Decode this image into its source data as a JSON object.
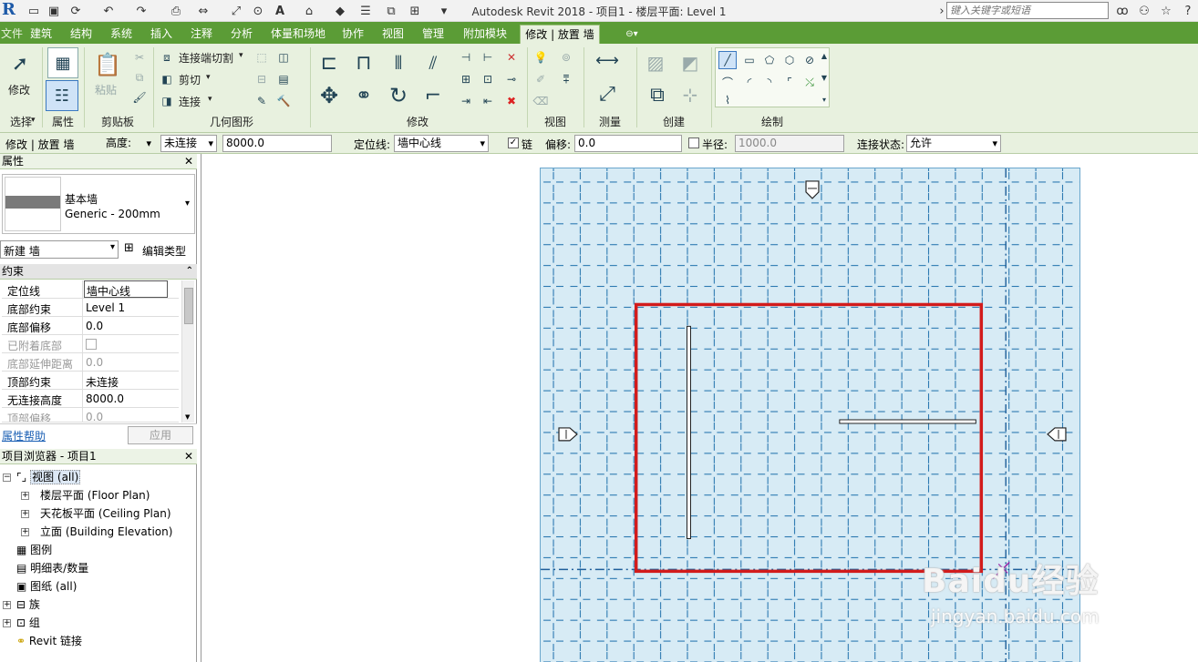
{
  "titlebar": {
    "app_logo": "R",
    "title": "Autodesk Revit 2018 -     项目1 - 楼层平面: Level 1",
    "search_placeholder": "键入关键字或短语",
    "icons": [
      "open-icon",
      "save-icon",
      "sync-icon",
      "undo-icon",
      "redo-icon",
      "print-icon",
      "measure-icon",
      "dimension-icon",
      "tag-icon",
      "text-icon",
      "3d-view-icon",
      "section-icon",
      "thin-lines-icon",
      "close-hidden-icon",
      "switch-windows-icon",
      "customize-icon",
      "binoculars-icon",
      "person-icon",
      "star-icon",
      "help-icon"
    ]
  },
  "tabs": [
    {
      "label": "文件"
    },
    {
      "label": "建筑"
    },
    {
      "label": "结构"
    },
    {
      "label": "系统"
    },
    {
      "label": "插入"
    },
    {
      "label": "注释"
    },
    {
      "label": "分析"
    },
    {
      "label": "体量和场地"
    },
    {
      "label": "协作"
    },
    {
      "label": "视图"
    },
    {
      "label": "管理"
    },
    {
      "label": "附加模块"
    },
    {
      "label": "修改 | 放置 墙",
      "active": true
    }
  ],
  "ribbon": {
    "modify_label": "修改",
    "paste_label": "粘贴",
    "join_cut_label": "连接端切割",
    "cut_label": "剪切",
    "join_label": "连接",
    "panels": {
      "select": "选择",
      "properties": "属性",
      "clipboard": "剪贴板",
      "geometry": "几何图形",
      "modify": "修改",
      "view": "视图",
      "measure": "测量",
      "create": "创建",
      "draw": "绘制"
    }
  },
  "optionsbar": {
    "context": "修改 | 放置 墙",
    "height_mode": "高度:",
    "top_constraint": "未连接",
    "height_value": "8000.0",
    "location_label": "定位线:",
    "location_value": "墙中心线",
    "chain_label": "链",
    "chain_checked": "✓",
    "offset_label": "偏移:",
    "offset_value": "0.0",
    "radius_label": "半径:",
    "radius_value": "1000.0",
    "join_status_label": "连接状态:",
    "join_status_value": "允许"
  },
  "properties": {
    "header": "属性",
    "type_family": "基本墙",
    "type_name": "Generic - 200mm",
    "instance_selector": "新建 墙",
    "edit_type": "编辑类型",
    "section": "约束",
    "rows": [
      {
        "key": "定位线",
        "value": "墙中心线",
        "dim": false
      },
      {
        "key": "底部约束",
        "value": "Level 1",
        "dim": false
      },
      {
        "key": "底部偏移",
        "value": "0.0",
        "dim": false
      },
      {
        "key": "已附着底部",
        "value": "",
        "dim": true
      },
      {
        "key": "底部延伸距离",
        "value": "0.0",
        "dim": true
      },
      {
        "key": "顶部约束",
        "value": "未连接",
        "dim": false
      },
      {
        "key": "无连接高度",
        "value": "8000.0",
        "dim": false
      },
      {
        "key": "顶部偏移",
        "value": "0.0",
        "dim": true
      }
    ],
    "help_link": "属性帮助",
    "apply": "应用"
  },
  "browser": {
    "header": "项目浏览器 - 项目1",
    "items": [
      {
        "label": "视图 (all)"
      },
      {
        "label": "楼层平面 (Floor Plan)"
      },
      {
        "label": "天花板平面 (Ceiling Plan)"
      },
      {
        "label": "立面 (Building Elevation)"
      },
      {
        "label": "图例"
      },
      {
        "label": "明细表/数量"
      },
      {
        "label": "图纸 (all)"
      },
      {
        "label": "族"
      },
      {
        "label": "组"
      },
      {
        "label": "Revit 链接"
      }
    ]
  },
  "watermark": {
    "brand": "Baidu经验",
    "url": "jingyan.baidu.com"
  },
  "colors": {
    "ribbon_green": "#5b9c36",
    "ribbon_bg": "#e8f1df",
    "grid_fill": "#d7ebf5",
    "grid_line": "#2a78b0",
    "highlight": "#d21b1b"
  }
}
